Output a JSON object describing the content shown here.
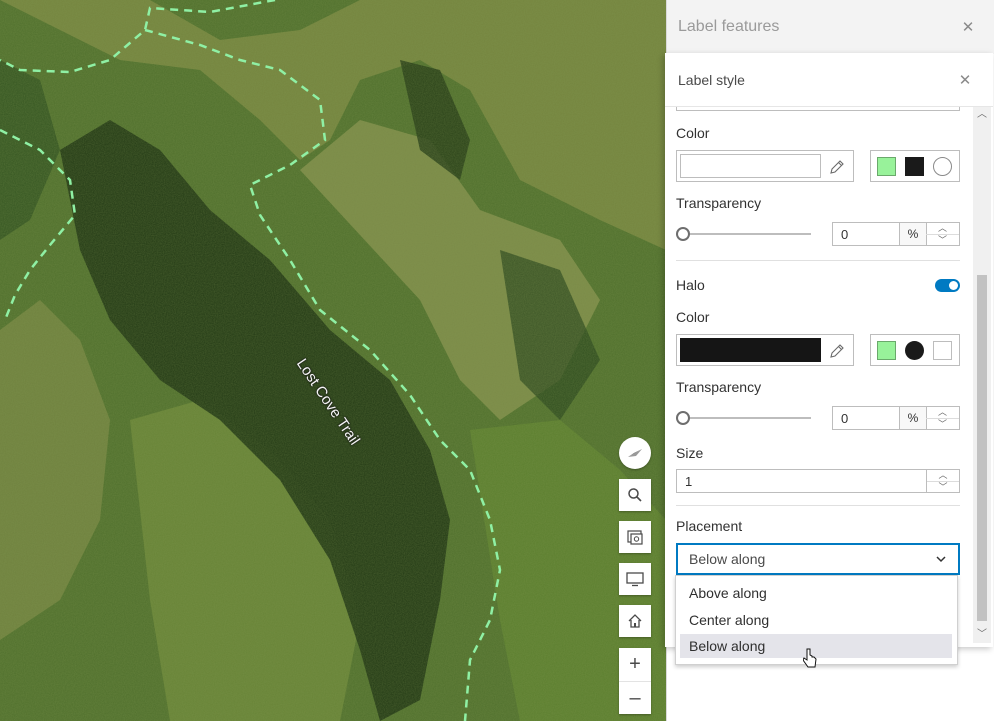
{
  "map": {
    "trail_label": "Lost Cove Trail",
    "trail_color": "#8ff0a4",
    "tools": {
      "compass_icon": "compass-icon",
      "search_icon": "search-icon",
      "basemap_icon": "basemap-gallery-icon",
      "fullscreen_icon": "monitor-icon",
      "home_icon": "home-icon",
      "zoom_in_label": "+",
      "zoom_out_label": "–"
    }
  },
  "panel": {
    "title": "Label features",
    "close_icon": "close-icon",
    "sub_panel": {
      "title": "Label style",
      "close_icon": "close-icon",
      "text_color": {
        "label": "Color",
        "value_color": "#ffffff",
        "presets": [
          "#98f29a",
          "#1a1a1a",
          "#ffffff"
        ]
      },
      "text_transparency": {
        "label": "Transparency",
        "value": "0",
        "unit": "%",
        "fraction": 0
      },
      "halo": {
        "label": "Halo",
        "enabled": true,
        "accent": "#007ac2"
      },
      "halo_color": {
        "label": "Color",
        "value_color": "#151515",
        "presets": [
          "#98f29a",
          "#1a1a1a",
          "#ffffff"
        ]
      },
      "halo_transparency": {
        "label": "Transparency",
        "value": "0",
        "unit": "%",
        "fraction": 0
      },
      "size": {
        "label": "Size",
        "value": "1"
      },
      "placement": {
        "label": "Placement",
        "selected": "Below along",
        "options": [
          "Above along",
          "Center along",
          "Below along"
        ]
      }
    }
  }
}
